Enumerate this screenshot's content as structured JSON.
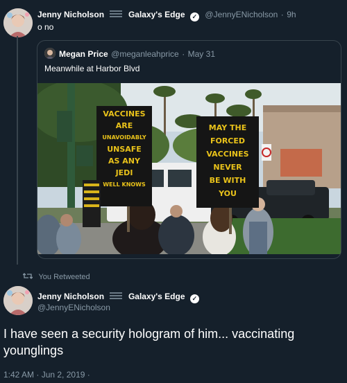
{
  "tweet1": {
    "display_name": "Jenny Nicholson",
    "name_suffix": "Galaxy's Edge",
    "handle": "@JennyENicholson",
    "time": "9h",
    "text": "o no"
  },
  "quoted": {
    "display_name": "Megan Price",
    "handle": "@meganleahprice",
    "date": "May 31",
    "text": "Meanwhile at Harbor Blvd",
    "sign_left_lines": [
      "VACCINES",
      "ARE",
      "UNAVOIDABLY",
      "UNSAFE",
      "AS ANY",
      "JEDI",
      "WELL KNOWS"
    ],
    "sign_right_lines": [
      "MAY THE",
      "FORCED",
      "VACCINES",
      "NEVER",
      "BE WITH",
      "YOU"
    ]
  },
  "retweet": {
    "label": "You Retweeted"
  },
  "tweet2": {
    "display_name": "Jenny Nicholson",
    "name_suffix": "Galaxy's Edge",
    "handle": "@JennyENicholson",
    "text": "I have seen a security hologram of him... vaccinating younglings",
    "timestamp": "1:42 AM · Jun 2, 2019 ·"
  },
  "colors": {
    "background": "#15202b",
    "muted": "#8899a6",
    "border": "#38444d",
    "sign_yellow": "#e9c21a"
  }
}
